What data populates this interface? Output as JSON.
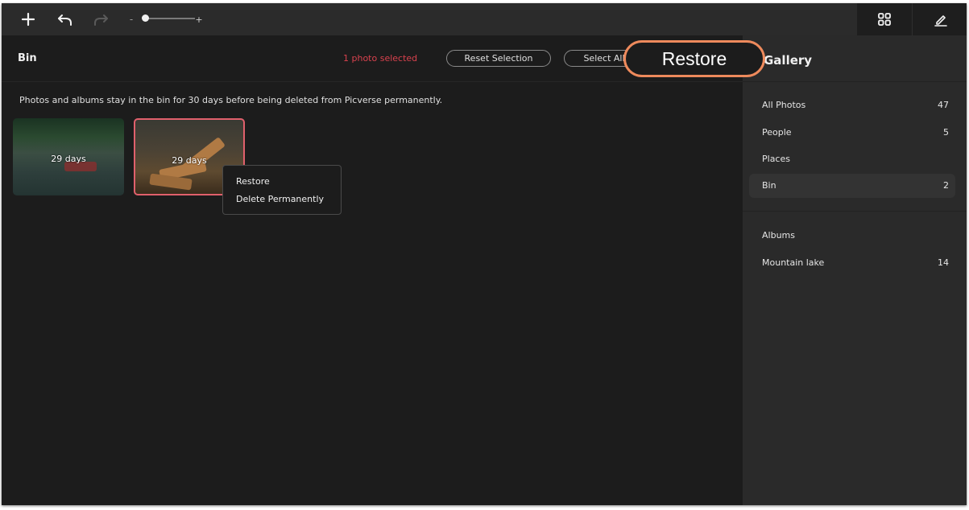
{
  "toolbar": {
    "add_icon": "plus-icon",
    "undo_icon": "undo-icon",
    "redo_icon": "redo-icon",
    "zoom_out_symbol": "-",
    "zoom_in_symbol": "+",
    "grid_icon": "grid-icon",
    "edit_icon": "pencil-icon"
  },
  "header": {
    "title": "Bin",
    "selection_status": "1 photo selected",
    "reset_selection_label": "Reset Selection",
    "select_all_label": "Select All",
    "restore_label": "Restore"
  },
  "main": {
    "info_text": "Photos and albums stay in the bin for 30 days before being deleted from Picverse permanently.",
    "photos": [
      {
        "days_label": "29 days",
        "selected": false
      },
      {
        "days_label": "29 days",
        "selected": true
      }
    ],
    "context_menu": {
      "items": [
        "Restore",
        "Delete Permanently"
      ]
    }
  },
  "sidebar": {
    "title": "Gallery",
    "items": [
      {
        "label": "All Photos",
        "count": "47"
      },
      {
        "label": "People",
        "count": "5"
      },
      {
        "label": "Places",
        "count": ""
      },
      {
        "label": "Bin",
        "count": "2",
        "active": true
      }
    ],
    "albums_heading": "Albums",
    "albums": [
      {
        "label": "Mountain lake",
        "count": "14"
      }
    ]
  },
  "colors": {
    "accent_red": "#d9424e",
    "callout_orange": "#ee8a5c",
    "background": "#1c1c1c",
    "sidebar_bg": "#2a2a2a"
  }
}
